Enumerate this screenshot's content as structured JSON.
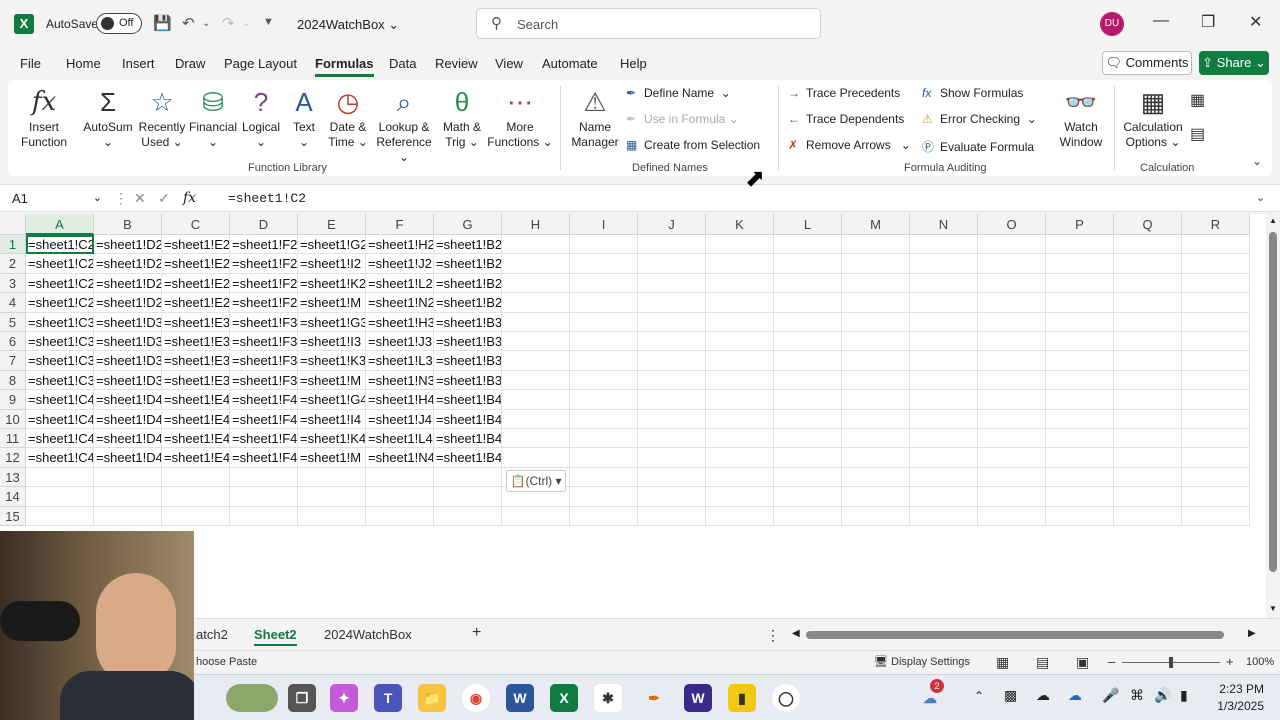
{
  "titlebar": {
    "app_icon": "excel-logo",
    "autosave_label": "AutoSave",
    "autosave_state": "Off",
    "doc_title": "2024WatchBox",
    "search_placeholder": "Search",
    "user_initials": "DU"
  },
  "menu": {
    "items": [
      "File",
      "Home",
      "Insert",
      "Draw",
      "Page Layout",
      "Formulas",
      "Data",
      "Review",
      "View",
      "Automate",
      "Help"
    ],
    "active": "Formulas",
    "comments_label": "Comments",
    "share_label": "Share"
  },
  "ribbon": {
    "function_library": {
      "label": "Function Library",
      "buttons": [
        {
          "line1": "Insert",
          "line2": "Function",
          "icon": "fx-icon"
        },
        {
          "line1": "AutoSum",
          "line2": "⌄",
          "icon": "sigma-icon"
        },
        {
          "line1": "Recently",
          "line2": "Used ⌄",
          "icon": "star-icon"
        },
        {
          "line1": "Financial",
          "line2": "⌄",
          "icon": "database-icon"
        },
        {
          "line1": "Logical",
          "line2": "⌄",
          "icon": "question-book-icon"
        },
        {
          "line1": "Text",
          "line2": "⌄",
          "icon": "text-a-icon"
        },
        {
          "line1": "Date &",
          "line2": "Time ⌄",
          "icon": "clock-icon"
        },
        {
          "line1": "Lookup &",
          "line2": "Reference ⌄",
          "icon": "magnifier-book-icon"
        },
        {
          "line1": "Math &",
          "line2": "Trig ⌄",
          "icon": "theta-icon"
        },
        {
          "line1": "More",
          "line2": "Functions ⌄",
          "icon": "more-icon"
        }
      ]
    },
    "defined_names": {
      "label": "Defined Names",
      "name_manager_line1": "Name",
      "name_manager_line2": "Manager",
      "define_name": "Define Name",
      "use_in_formula": "Use in Formula",
      "create_from_selection": "Create from Selection"
    },
    "formula_auditing": {
      "label": "Formula Auditing",
      "trace_precedents": "Trace Precedents",
      "trace_dependents": "Trace Dependents",
      "remove_arrows": "Remove Arrows",
      "show_formulas": "Show Formulas",
      "error_checking": "Error Checking",
      "evaluate_formula": "Evaluate Formula",
      "watch_window_line1": "Watch",
      "watch_window_line2": "Window"
    },
    "calculation": {
      "label": "Calculation",
      "options_line1": "Calculation",
      "options_line2": "Options ⌄"
    }
  },
  "formula_bar": {
    "name_box": "A1",
    "formula": "=sheet1!C2"
  },
  "grid": {
    "columns": [
      "A",
      "B",
      "C",
      "D",
      "E",
      "F",
      "G",
      "H",
      "I",
      "J",
      "K",
      "L",
      "M",
      "N",
      "O",
      "P",
      "Q",
      "R"
    ],
    "row_numbers": [
      "1",
      "2",
      "3",
      "4",
      "5",
      "6",
      "7",
      "8",
      "9",
      "10",
      "11",
      "12",
      "13",
      "14",
      "15"
    ],
    "rows": [
      [
        "=sheet1!C2",
        "=sheet1!D2",
        "=sheet1!E2",
        "=sheet1!F2",
        "=sheet1!G2",
        "=sheet1!H2",
        "=sheet1!B2"
      ],
      [
        "=sheet1!C2",
        "=sheet1!D2",
        "=sheet1!E2",
        "=sheet1!F2",
        "=sheet1!I2",
        "=sheet1!J2",
        "=sheet1!B2"
      ],
      [
        "=sheet1!C2",
        "=sheet1!D2",
        "=sheet1!E2",
        "=sheet1!F2",
        "=sheet1!K2",
        "=sheet1!L2",
        "=sheet1!B2"
      ],
      [
        "=sheet1!C2",
        "=sheet1!D2",
        "=sheet1!E2",
        "=sheet1!F2",
        "=sheet1!M",
        "=sheet1!N2",
        "=sheet1!B2"
      ],
      [
        "=sheet1!C3",
        "=sheet1!D3",
        "=sheet1!E3",
        "=sheet1!F3",
        "=sheet1!G3",
        "=sheet1!H3",
        "=sheet1!B3"
      ],
      [
        "=sheet1!C3",
        "=sheet1!D3",
        "=sheet1!E3",
        "=sheet1!F3",
        "=sheet1!I3",
        "=sheet1!J3",
        "=sheet1!B3"
      ],
      [
        "=sheet1!C3",
        "=sheet1!D3",
        "=sheet1!E3",
        "=sheet1!F3",
        "=sheet1!K3",
        "=sheet1!L3",
        "=sheet1!B3"
      ],
      [
        "=sheet1!C3",
        "=sheet1!D3",
        "=sheet1!E3",
        "=sheet1!F3",
        "=sheet1!M",
        "=sheet1!N3",
        "=sheet1!B3"
      ],
      [
        "=sheet1!C4",
        "=sheet1!D4",
        "=sheet1!E4",
        "=sheet1!F4",
        "=sheet1!G4",
        "=sheet1!H4",
        "=sheet1!B4"
      ],
      [
        "=sheet1!C4",
        "=sheet1!D4",
        "=sheet1!E4",
        "=sheet1!F4",
        "=sheet1!I4",
        "=sheet1!J4",
        "=sheet1!B4"
      ],
      [
        "=sheet1!C4",
        "=sheet1!D4",
        "=sheet1!E4",
        "=sheet1!F4",
        "=sheet1!K4",
        "=sheet1!L4",
        "=sheet1!B4"
      ],
      [
        "=sheet1!C4",
        "=sheet1!D4",
        "=sheet1!E4",
        "=sheet1!F4",
        "=sheet1!M",
        "=sheet1!N4",
        "=sheet1!B4"
      ]
    ],
    "paste_options_label": "(Ctrl)"
  },
  "sheet_tabs": {
    "tabs": [
      "atch2",
      "Sheet2",
      "2024WatchBox"
    ],
    "active": "Sheet2",
    "add_label": "+"
  },
  "status_bar": {
    "message": "hoose Paste",
    "display_settings": "Display Settings",
    "zoom": "100%"
  },
  "taskbar": {
    "notification_badge": "2",
    "time": "2:23 PM",
    "date": "1/3/2025"
  },
  "colors": {
    "accent": "#107c41",
    "share_bg": "#107c41",
    "avatar_bg": "#b4196b"
  }
}
